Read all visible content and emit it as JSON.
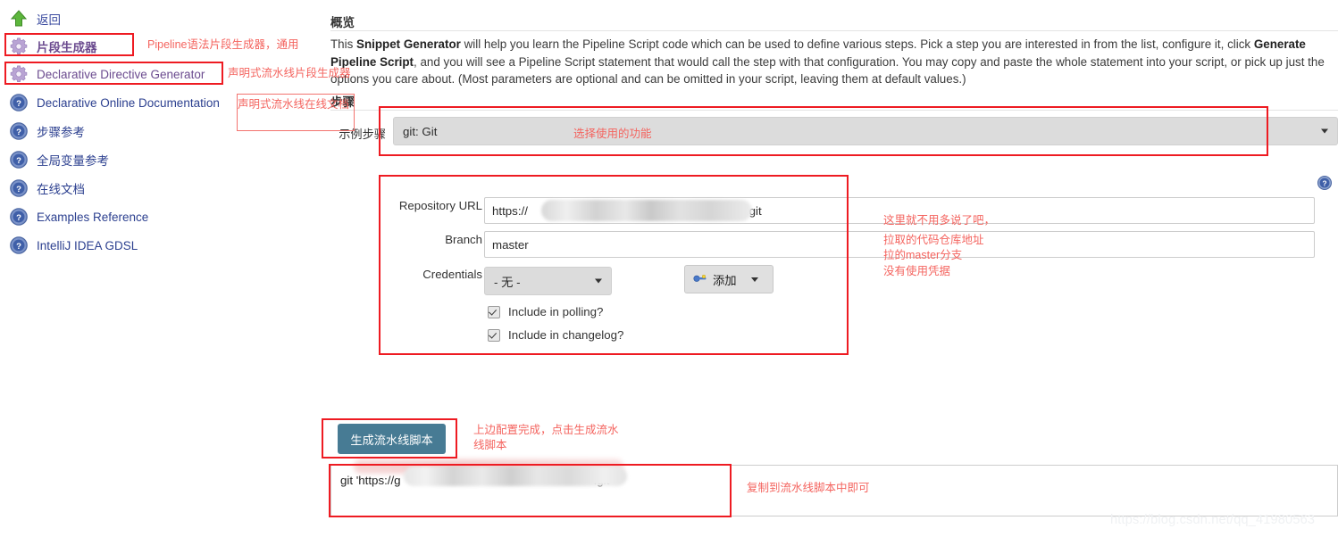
{
  "sidebar": {
    "items": [
      {
        "label": "返回",
        "icon": "up-arrow-icon",
        "style": "back"
      },
      {
        "label": "片段生成器",
        "icon": "gear-icon",
        "style": "bold-purple"
      },
      {
        "label": "Declarative Directive Generator",
        "icon": "gear-icon",
        "style": "purple"
      },
      {
        "label": "Declarative Online Documentation",
        "icon": "help-icon",
        "style": "blue"
      },
      {
        "label": "步骤参考",
        "icon": "help-icon",
        "style": "blue"
      },
      {
        "label": "全局变量参考",
        "icon": "help-icon",
        "style": "blue"
      },
      {
        "label": "在线文档",
        "icon": "help-icon",
        "style": "blue"
      },
      {
        "label": "Examples Reference",
        "icon": "help-icon",
        "style": "blue"
      },
      {
        "label": "IntelliJ IDEA GDSL",
        "icon": "help-icon",
        "style": "blue"
      }
    ]
  },
  "annotations": {
    "snippet_generator": "Pipeline语法片段生成器，通用",
    "declarative_directive": "声明式流水线片段生成器",
    "declarative_online_doc": "声明式流水线在线文档",
    "select_function": "选择使用的功能",
    "repo_note_1": "这里就不用多说了吧，",
    "repo_note_2": "拉取的代码仓库地址",
    "repo_note_3": "拉的master分支",
    "repo_note_4": "没有使用凭据",
    "generate_note": "上边配置完成，点击生成流水线脚本",
    "copy_note": "复制到流水线脚本中即可"
  },
  "overview": {
    "title": "概览",
    "body_segments": [
      {
        "text": "This ",
        "bold": false
      },
      {
        "text": "Snippet Generator",
        "bold": true
      },
      {
        "text": " will help you learn the Pipeline Script code which can be used to define various steps. Pick a step you are interested in from the list, configure it, click ",
        "bold": false
      },
      {
        "text": "Generate Pipeline Script",
        "bold": true
      },
      {
        "text": ", and you will see a Pipeline Script statement that would call the step with that configuration. You may copy and paste the whole statement into your script, or pick up just the options you care about. (Most parameters are optional and can be omitted in your script, leaving them at default values.)",
        "bold": false
      }
    ]
  },
  "steps": {
    "title": "步骤",
    "sample_step_label": "示例步骤",
    "selected_step": "git: Git"
  },
  "form": {
    "repository_url": {
      "label": "Repository URL",
      "prefix": "https://",
      "suffix": ".git"
    },
    "branch": {
      "label": "Branch",
      "value": "master"
    },
    "credentials": {
      "label": "Credentials",
      "value": "- 无 -",
      "add_button": "添加"
    },
    "checkboxes": [
      {
        "label": "Include in polling?",
        "checked": true
      },
      {
        "label": "Include in changelog?",
        "checked": true
      }
    ]
  },
  "generate": {
    "button_label": "生成流水线脚本",
    "output_prefix": "git 'https://g",
    "output_suffix": ".git'"
  },
  "watermark": {
    "text": "https://blog.csdn.net/qq_41980563"
  },
  "colors": {
    "annotation_red": "#f4645f",
    "box_red": "#ee1b22",
    "generate_button": "#477b94",
    "link_purple": "#6b4b8f",
    "link_blue": "#2b3f8f"
  }
}
